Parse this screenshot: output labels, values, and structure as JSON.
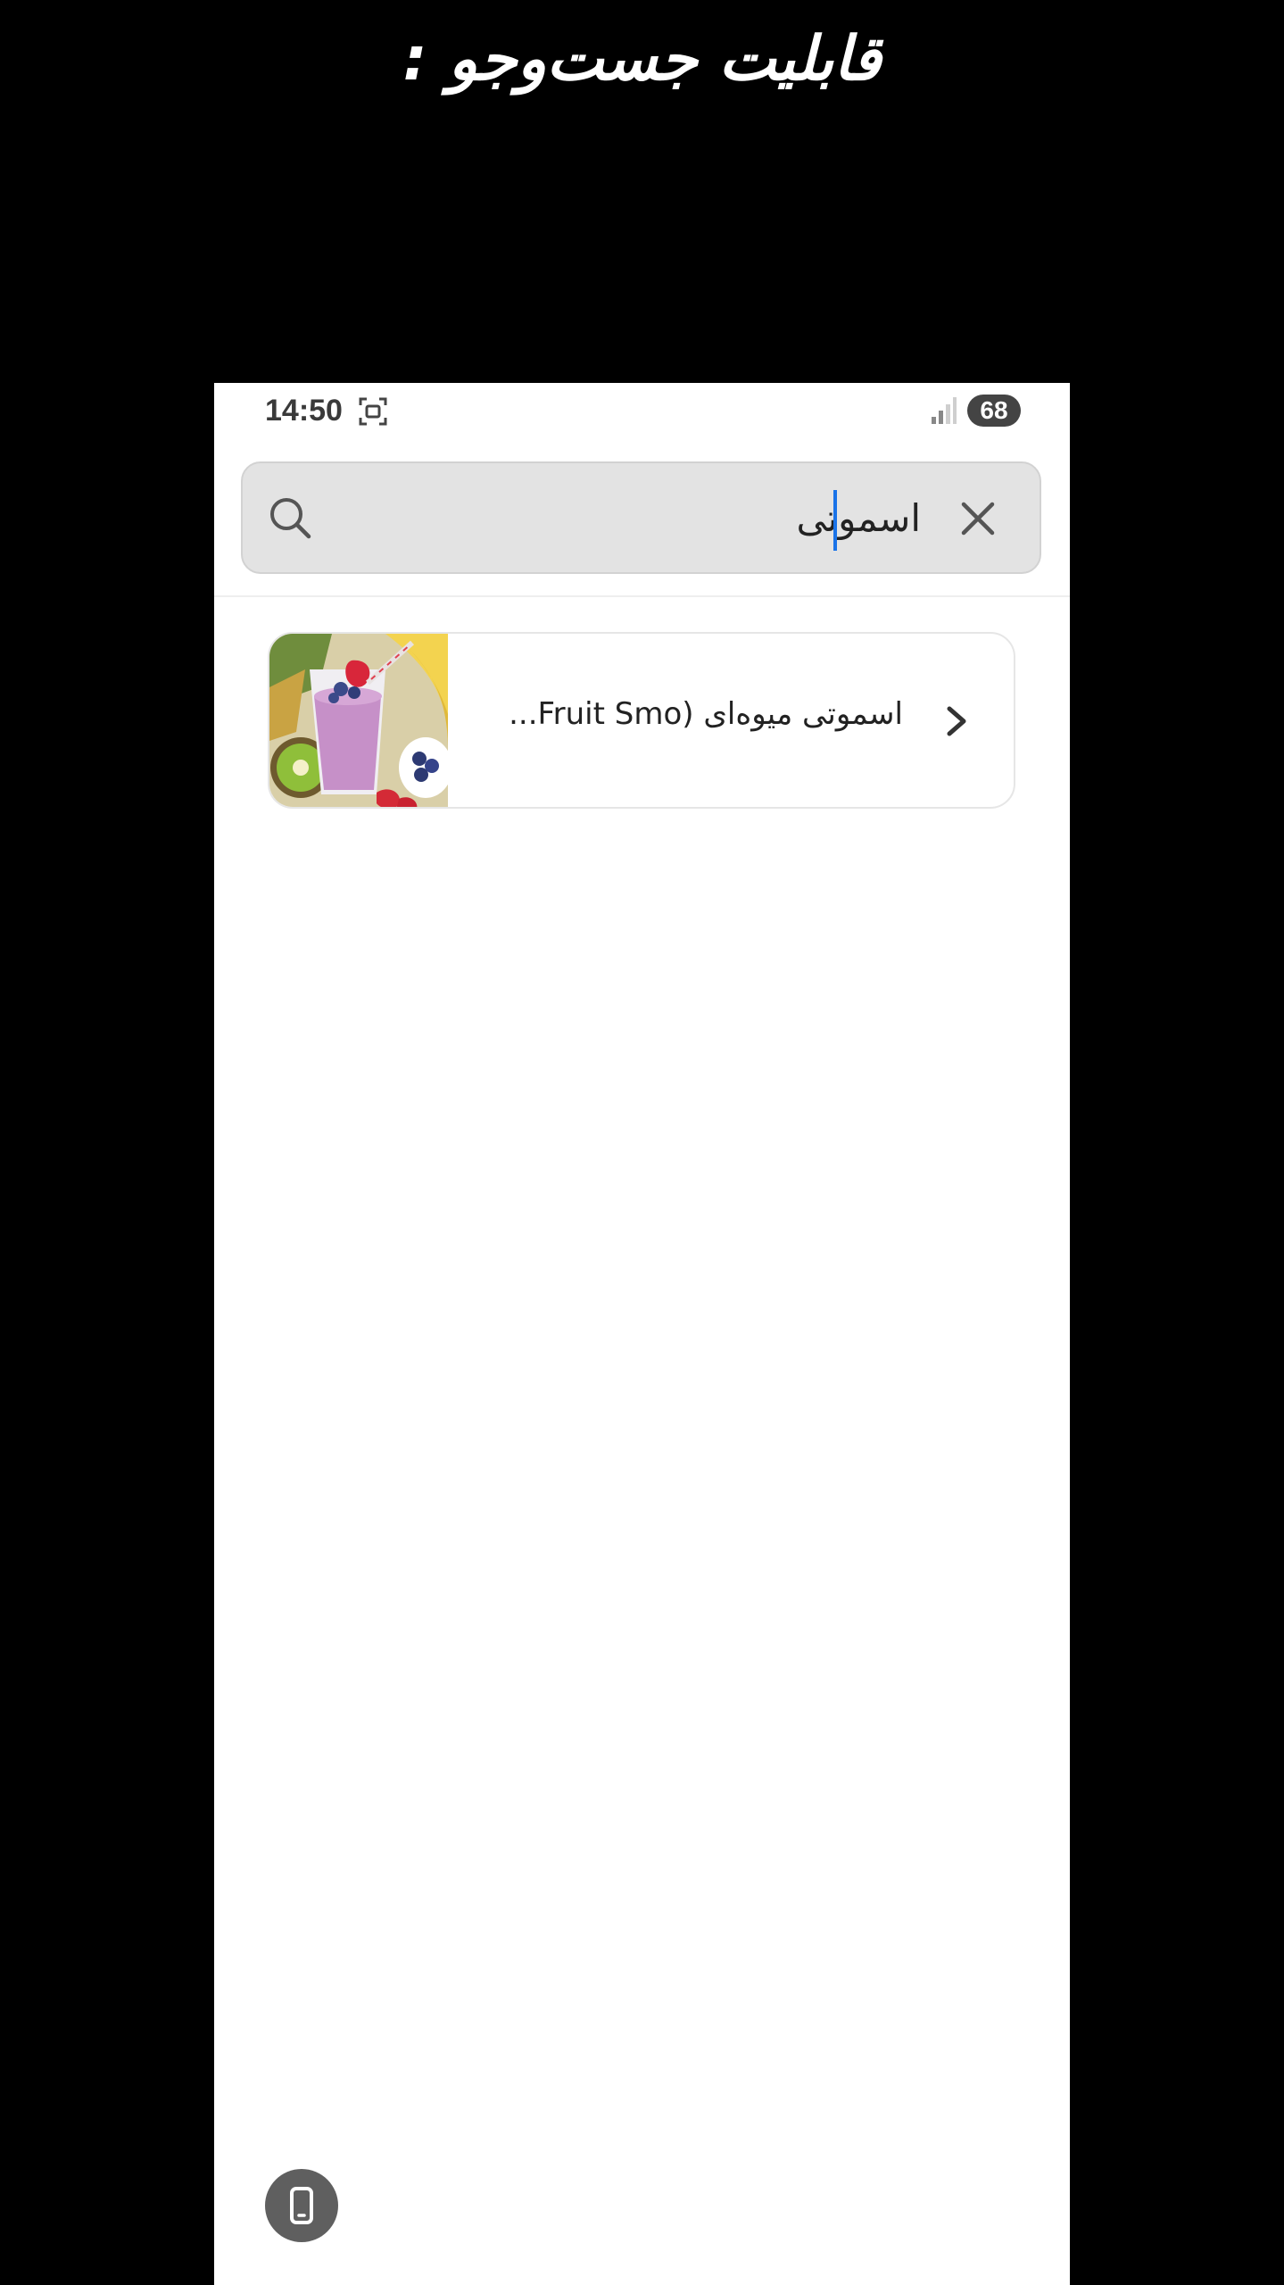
{
  "caption": "قابلیت جست‌وجو :",
  "status_bar": {
    "time": "14:50",
    "battery": "68",
    "screen_icon": "screenshot-frame-icon",
    "signal_icon": "signal-bars-icon"
  },
  "search": {
    "value": "اسموتی",
    "search_icon": "search-icon",
    "clear_icon": "close-icon",
    "accent_color": "#1a73e8"
  },
  "results": [
    {
      "title": "اسموتی میوه‌ای (Fruit Smo...",
      "thumbnail": "fruit-smoothie-image",
      "chevron_icon": "chevron-right-icon"
    }
  ],
  "floating_button": {
    "icon": "phone-icon"
  }
}
